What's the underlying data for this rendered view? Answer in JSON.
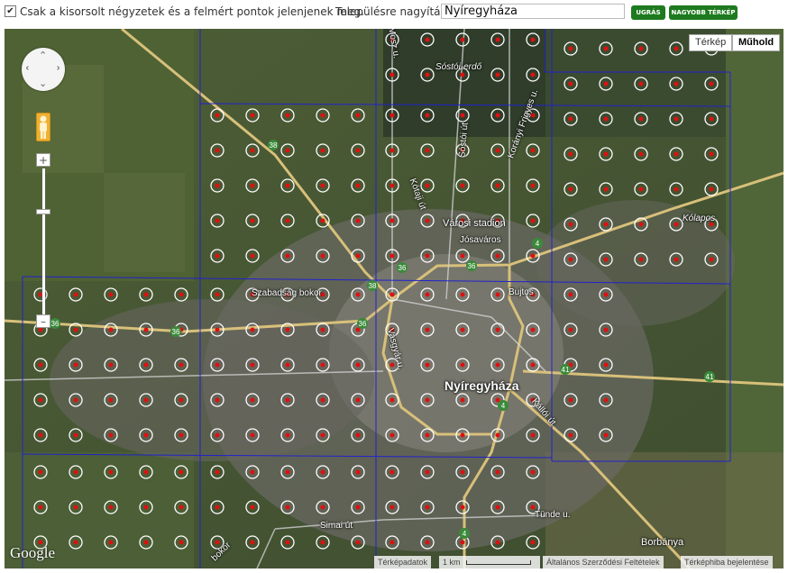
{
  "toolbar": {
    "checkbox_checked": true,
    "checkbox_label": "Csak a kisorsolt négyzetek és a felmért pontok jelenjenek meg.",
    "zoom_label": "Településre nagyítás:",
    "zoom_input_value": "Nyíregyháza",
    "jump_button": "UGRÁS",
    "bigger_map_button": "NAGYOBB TÉRKÉP"
  },
  "map": {
    "type_buttons": [
      "Térkép",
      "Műhold"
    ],
    "active_type": "Műhold",
    "labels": {
      "city": "Nyíregyháza",
      "stadium": "Városi stadion",
      "sostoi": "Sóstói-erdő",
      "josavaros": "Jósaváros",
      "kolapos": "Kólapos",
      "bujtos": "Bujtos",
      "borbanya": "Borbánya",
      "szabadsag": "Szabadság bokor",
      "simai": "Simai út",
      "tunde": "Tünde u.",
      "korte": "Kótaji út",
      "sostoi_ut": "Sóstói út",
      "koranyi": "Korányi Frigyes u.",
      "vasgyar": "Vasgyár u.",
      "kallo": "Kállói út",
      "mosz": "Mosz u.",
      "bokor": "bokor"
    },
    "road_numbers": [
      "38",
      "36",
      "36",
      "36",
      "36",
      "36",
      "38",
      "4",
      "4",
      "41",
      "41",
      "4"
    ],
    "logo": "Google",
    "footer": {
      "data": "Térképadatok",
      "scale": "1 km",
      "terms": "Általános Szerződési Feltételek",
      "report": "Térképhiba bejelentése"
    },
    "colors": {
      "grid": "#2222cc",
      "point_fill": "#e01010",
      "point_ring": "#ffffff",
      "button_green": "#1e7a1e"
    }
  }
}
